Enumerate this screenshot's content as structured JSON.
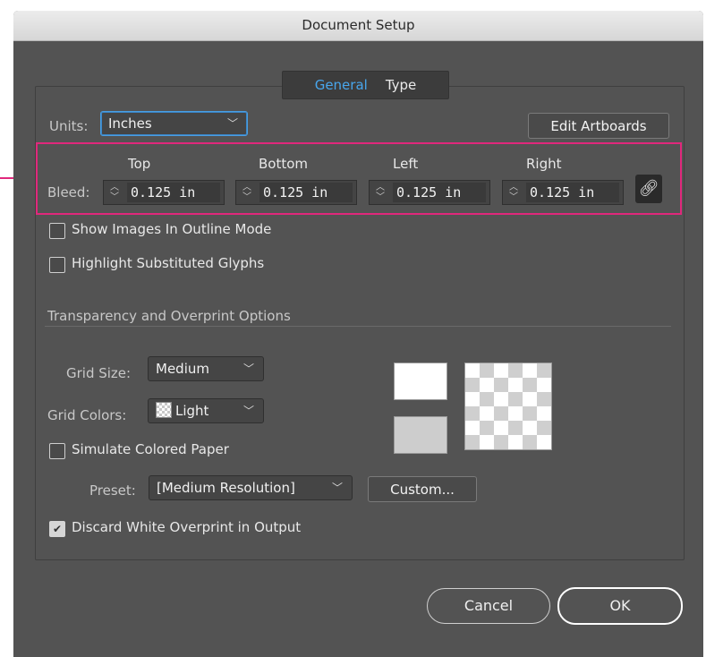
{
  "window": {
    "title": "Document Setup"
  },
  "tabs": [
    {
      "label": "General",
      "active": true
    },
    {
      "label": "Type",
      "active": false
    }
  ],
  "units": {
    "label": "Units:",
    "value": "Inches"
  },
  "edit_artboards_label": "Edit Artboards",
  "bleed": {
    "label": "Bleed:",
    "fields": [
      {
        "label": "Top",
        "value": "0.125 in"
      },
      {
        "label": "Bottom",
        "value": "0.125 in"
      },
      {
        "label": "Left",
        "value": "0.125 in"
      },
      {
        "label": "Right",
        "value": "0.125 in"
      }
    ],
    "link_icon": "chain-link-icon"
  },
  "options": {
    "show_images_outline": "Show Images In Outline Mode",
    "highlight_substituted": "Highlight Substituted Glyphs"
  },
  "transparency": {
    "section_title": "Transparency and Overprint Options",
    "grid_size_label": "Grid Size:",
    "grid_size_value": "Medium",
    "grid_colors_label": "Grid Colors:",
    "grid_colors_value": "Light",
    "simulate_paper": "Simulate Colored Paper",
    "preset_label": "Preset:",
    "preset_value": "[Medium Resolution]",
    "custom_label": "Custom...",
    "discard_white": "Discard White Overprint in Output",
    "discard_white_checked": true
  },
  "buttons": {
    "cancel": "Cancel",
    "ok": "OK"
  },
  "colors": {
    "accent": "#48a6ec",
    "highlight": "#e0287c",
    "panel": "#535353"
  }
}
